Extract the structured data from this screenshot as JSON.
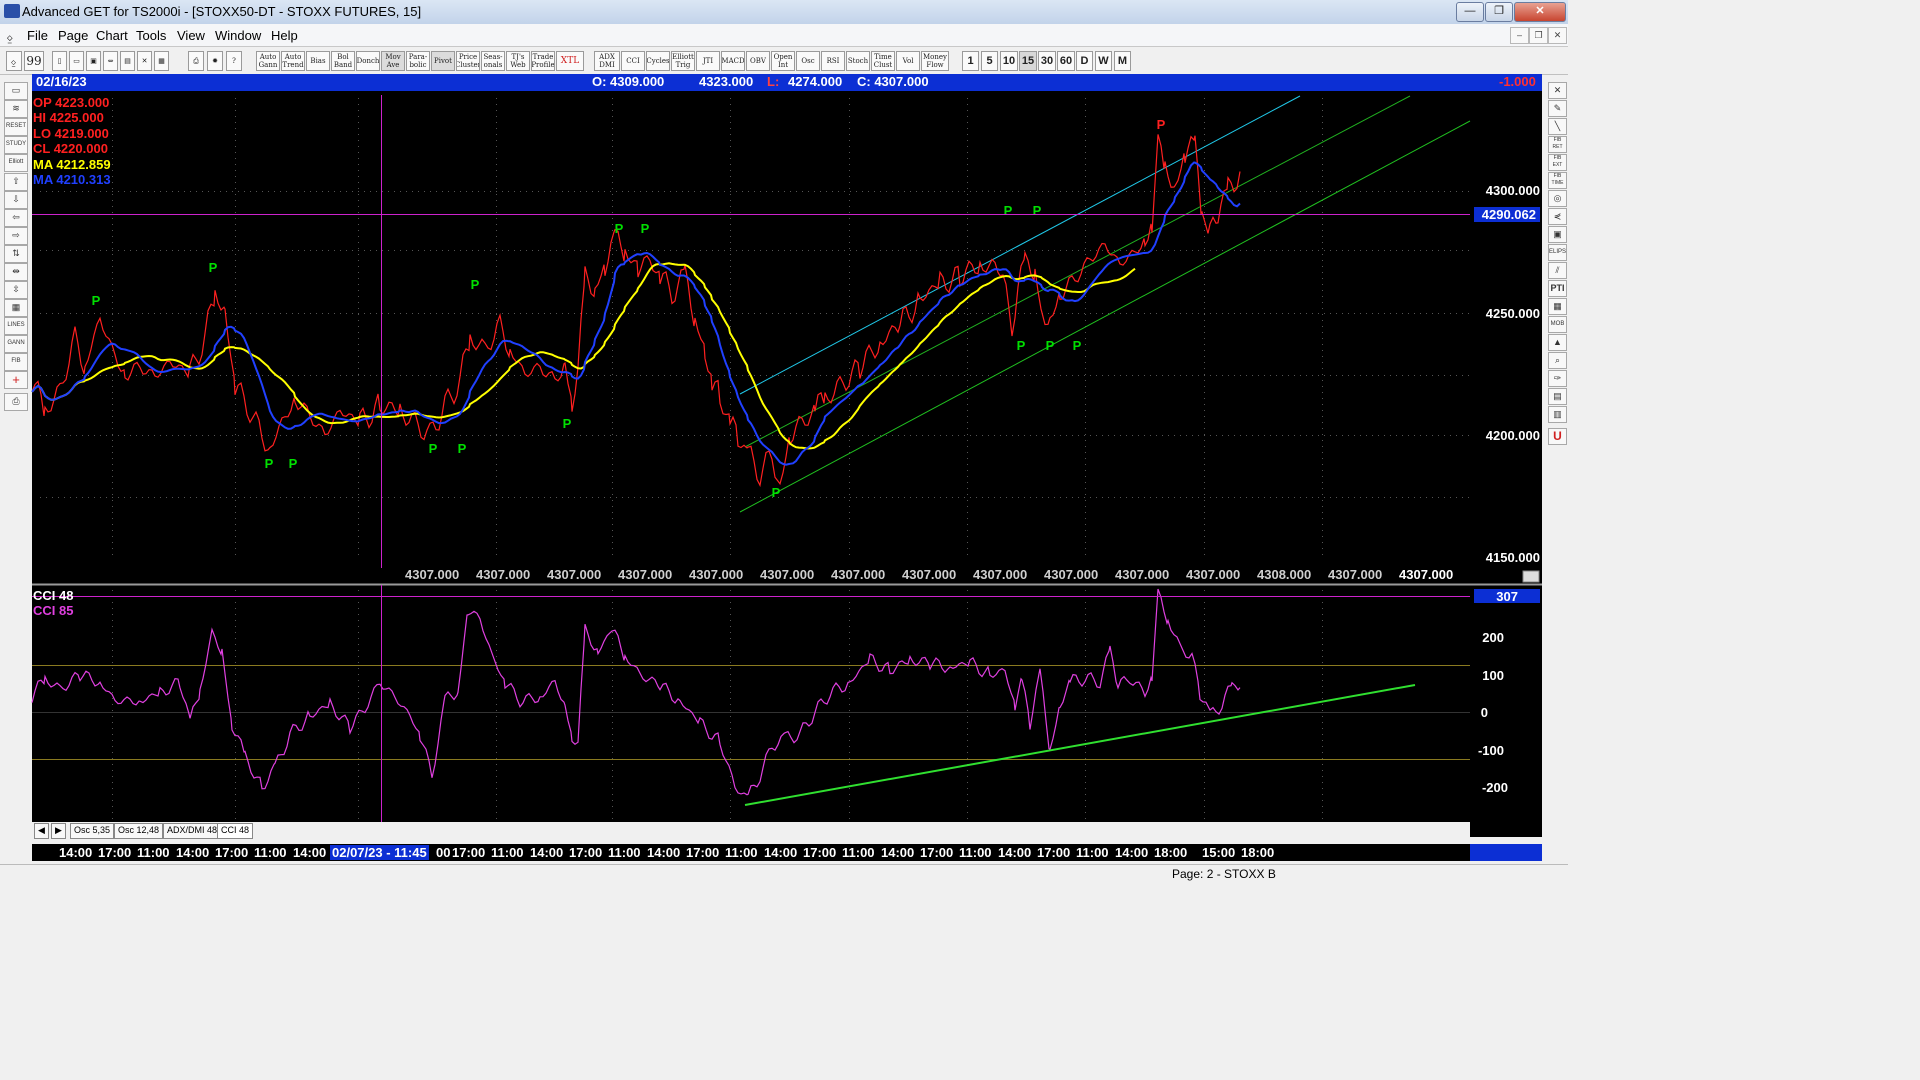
{
  "window": {
    "title": "Advanced GET for TS2000i - [STOXX50-DT - STOXX FUTURES, 15]",
    "faded_title": "STOXX50-DT - STOXX FUTURES"
  },
  "menu": [
    "File",
    "Page",
    "Chart",
    "Tools",
    "View",
    "Window",
    "Help"
  ],
  "toolbar": {
    "study_buttons": [
      "Auto Gann",
      "Auto Trend",
      "Bias",
      "Bol Band",
      "Donch",
      "Mov Ave",
      "Para-bolic",
      "Pivot",
      "Price Cluster",
      "Seas-onals",
      "TJ's Web",
      "Trade Profile",
      "XTL",
      "ADX DMI",
      "CCI",
      "Cycles",
      "Elliott Trig",
      "JTI",
      "MACD",
      "OBV",
      "Open Int",
      "Osc",
      "RSI",
      "Stoch",
      "Time Clust",
      "Vol",
      "Money Flow"
    ],
    "timeframes": [
      "1",
      "5",
      "10",
      "15",
      "30",
      "60",
      "D",
      "W",
      "M"
    ]
  },
  "infobar": {
    "date": "02/16/23",
    "open": "O: 4309.000",
    "high": "4323.000",
    "low_label": "L:",
    "low": "4274.000",
    "close": "C: 4307.000",
    "right_value": "-1.000"
  },
  "overlay": {
    "op": "OP  4223.000",
    "hi": "HI   4225.000",
    "lo": "LO  4219.000",
    "cl": "CL  4220.000",
    "ma1": "MA  4212.859",
    "ma2": "MA  4210.313"
  },
  "price_axis": [
    "4300.000",
    "4250.000",
    "4200.000",
    "4150.000"
  ],
  "price_marker": "4290.062",
  "x_strip": [
    "4307.000",
    "4307.000",
    "4307.000",
    "4307.000",
    "4307.000",
    "4307.000",
    "4307.000",
    "4307.000",
    "4307.000",
    "4307.000",
    "4307.000",
    "4307.000",
    "4308.000",
    "4307.000",
    "4307.000"
  ],
  "cci_panel": {
    "label1": "CCI 48",
    "label2": "CCI  85",
    "axis": [
      "200",
      "100",
      "0",
      "-100",
      "-200"
    ],
    "marker": "307"
  },
  "tabs": [
    "Osc 5,35",
    "Osc 12,48",
    "ADX/DMI 48",
    "CCI 48"
  ],
  "time_axis": {
    "labels": [
      "14:00",
      "17:00",
      "11:00",
      "14:00",
      "17:00",
      "11:00",
      "14:00",
      "02/07/23 - 11:45",
      "00",
      "17:00",
      "11:00",
      "14:00",
      "17:00",
      "11:00",
      "14:00",
      "17:00",
      "11:00",
      "14:00",
      "17:00",
      "11:00",
      "14:00",
      "17:00",
      "11:00",
      "14:00",
      "17:00",
      "11:00",
      "14:00",
      "18:00",
      "15:00",
      "18:00"
    ]
  },
  "status": "Page: 2 - STOXX B",
  "colors": {
    "price": "#ff2020",
    "ma_yellow": "#ffff00",
    "ma_blue": "#2040ff",
    "pivot": "#00e000",
    "cci": "#e040e0",
    "cursor": "#cc22cc",
    "channel_cyan": "#20c8e8",
    "channel_green": "#20c020"
  }
}
